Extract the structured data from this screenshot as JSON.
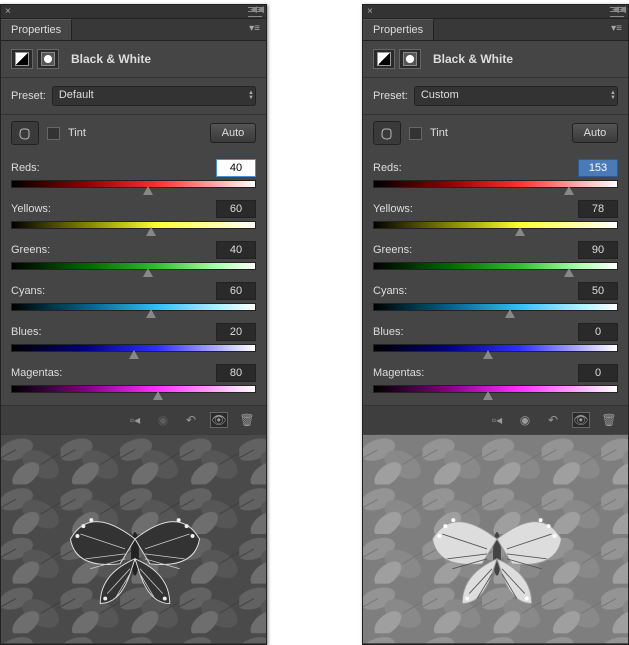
{
  "panels": [
    {
      "tab": "Properties",
      "title": "Black & White",
      "preset_label": "Preset:",
      "preset_value": "Default",
      "tint_label": "Tint",
      "auto_label": "Auto",
      "sliders": {
        "reds": {
          "label": "Reds:",
          "value": "40",
          "pos": 56,
          "active": true,
          "sel": false
        },
        "yellows": {
          "label": "Yellows:",
          "value": "60",
          "pos": 57,
          "active": false,
          "sel": false
        },
        "greens": {
          "label": "Greens:",
          "value": "40",
          "pos": 56,
          "active": false,
          "sel": false
        },
        "cyans": {
          "label": "Cyans:",
          "value": "60",
          "pos": 57,
          "active": false,
          "sel": false
        },
        "blues": {
          "label": "Blues:",
          "value": "20",
          "pos": 50,
          "active": false,
          "sel": false
        },
        "magentas": {
          "label": "Magentas:",
          "value": "80",
          "pos": 60,
          "active": false,
          "sel": false
        }
      }
    },
    {
      "tab": "Properties",
      "title": "Black & White",
      "preset_label": "Preset:",
      "preset_value": "Custom",
      "tint_label": "Tint",
      "auto_label": "Auto",
      "sliders": {
        "reds": {
          "label": "Reds:",
          "value": "153",
          "pos": 80,
          "active": false,
          "sel": true
        },
        "yellows": {
          "label": "Yellows:",
          "value": "78",
          "pos": 60,
          "active": false,
          "sel": false
        },
        "greens": {
          "label": "Greens:",
          "value": "90",
          "pos": 80,
          "active": false,
          "sel": false
        },
        "cyans": {
          "label": "Cyans:",
          "value": "50",
          "pos": 56,
          "active": false,
          "sel": false
        },
        "blues": {
          "label": "Blues:",
          "value": "0",
          "pos": 47,
          "active": false,
          "sel": false
        },
        "magentas": {
          "label": "Magentas:",
          "value": "0",
          "pos": 47,
          "active": false,
          "sel": false
        }
      }
    }
  ]
}
